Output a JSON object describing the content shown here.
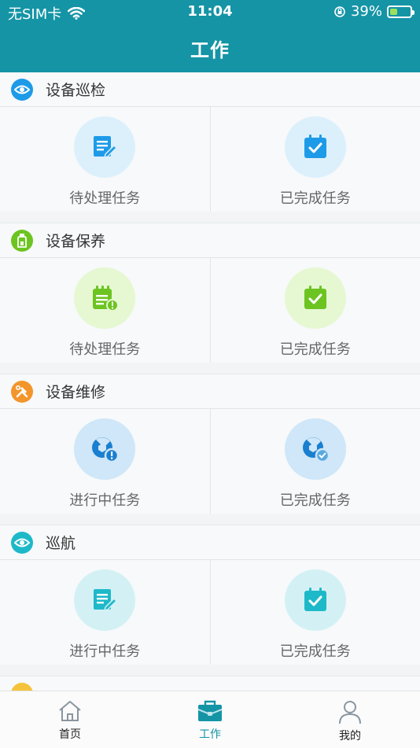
{
  "status": {
    "carrier": "无SIM卡",
    "time": "11:04",
    "battery_text": "39%",
    "battery_level_pct": 39
  },
  "header": {
    "title": "工作"
  },
  "sections": [
    {
      "title": "设备巡检",
      "icon": "eye-icon",
      "cards": [
        {
          "label": "待处理任务",
          "icon": "edit-document-icon"
        },
        {
          "label": "已完成任务",
          "icon": "calendar-check-icon"
        }
      ]
    },
    {
      "title": "设备保养",
      "icon": "bottle-icon",
      "cards": [
        {
          "label": "待处理任务",
          "icon": "notepad-alert-icon"
        },
        {
          "label": "已完成任务",
          "icon": "calendar-check-icon"
        }
      ]
    },
    {
      "title": "设备维修",
      "icon": "tools-icon",
      "cards": [
        {
          "label": "进行中任务",
          "icon": "wrench-alert-icon"
        },
        {
          "label": "已完成任务",
          "icon": "wrench-check-icon"
        }
      ]
    },
    {
      "title": "巡航",
      "icon": "eye-icon",
      "cards": [
        {
          "label": "进行中任务",
          "icon": "edit-document-icon"
        },
        {
          "label": "已完成任务",
          "icon": "calendar-check-icon"
        }
      ]
    }
  ],
  "tabbar": [
    {
      "label": "首页",
      "icon": "home-icon"
    },
    {
      "label": "工作",
      "icon": "briefcase-icon"
    },
    {
      "label": "我的",
      "icon": "user-icon"
    }
  ],
  "colors": {
    "header_bg": "#1594a6",
    "inspection_blue": "#1e9be8",
    "maintenance_green": "#6cc421",
    "repair_orange": "#f3952b",
    "cruise_cyan": "#1eb9c9"
  }
}
